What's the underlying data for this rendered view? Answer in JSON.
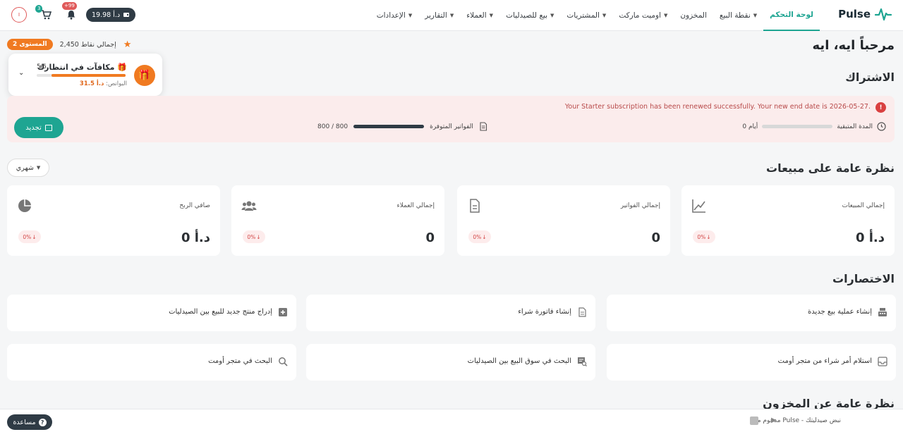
{
  "brand": {
    "name": "Pulse",
    "color": "#1ea592"
  },
  "nav": {
    "items": [
      {
        "label": "لوحة التحكم",
        "active": true,
        "dropdown": false
      },
      {
        "label": "نقطة البيع",
        "dropdown": true
      },
      {
        "label": "المخزون",
        "dropdown": false
      },
      {
        "label": "اوميت ماركت",
        "dropdown": true
      },
      {
        "label": "المشتريات",
        "dropdown": true
      },
      {
        "label": "بيع للصيدليات",
        "dropdown": true
      },
      {
        "label": "العملاء",
        "dropdown": true
      },
      {
        "label": "التقارير",
        "dropdown": true
      },
      {
        "label": "الإعدادات",
        "dropdown": true
      }
    ],
    "balance": "د.أ 19.98",
    "notifications_badge": "+99",
    "cart_badge": "3"
  },
  "greeting": "مرحباً ايه، ايه",
  "points": {
    "level": "المستوى 2",
    "total": "إجمالي نقاط 2,450"
  },
  "rewards": {
    "title": "مكافآت في انتظارك",
    "count": "5/6",
    "progress": 0.83,
    "bonus_label": "البوانص:",
    "bonus_value": "د.أ 31.5"
  },
  "subscription": {
    "heading": "الاشتراك",
    "message": "Your Starter subscription has been renewed successfully. Your new end date is 2026-05-27.",
    "remaining_label": "المدة المتبقية",
    "remaining_value": "0 أيام",
    "invoices_label": "الفواتير المتوفرة",
    "invoices_value": "800 / 800",
    "renew_label": "تجديد"
  },
  "sales": {
    "heading": "نظرة عامة على مبيعات",
    "period": "شهري",
    "cards": [
      {
        "label": "إجمالي المبيعات",
        "value": "د.أ 0",
        "change": "0%",
        "icon": "trend-icon"
      },
      {
        "label": "إجمالي الفواتير",
        "value": "0",
        "change": "0%",
        "icon": "invoice-icon"
      },
      {
        "label": "إجمالي العملاء",
        "value": "0",
        "change": "0%",
        "icon": "users-icon"
      },
      {
        "label": "صافي الربح",
        "value": "د.أ 0",
        "change": "0%",
        "icon": "pie-icon"
      }
    ]
  },
  "shortcuts": {
    "heading": "الاختصارات",
    "items": [
      {
        "label": "إنشاء عملية بيع جديدة",
        "icon": "register-icon"
      },
      {
        "label": "إنشاء فاتورة شراء",
        "icon": "document-icon"
      },
      {
        "label": "إدراج منتج جديد للبيع بين الصيدليات",
        "icon": "plus-box-icon"
      },
      {
        "label": "استلام أمر شراء من متجر أومت",
        "icon": "inbox-icon"
      },
      {
        "label": "البحث في سوق البيع بين الصيدليات",
        "icon": "search-list-icon"
      },
      {
        "label": "البحث في متجر أومت",
        "icon": "search-icon"
      }
    ]
  },
  "inventory": {
    "heading": "نظرة عامة عن المخزون"
  },
  "footer": {
    "text": "مدعوم من Pulse - نبض صيدليتك",
    "help": "مساعدة"
  }
}
